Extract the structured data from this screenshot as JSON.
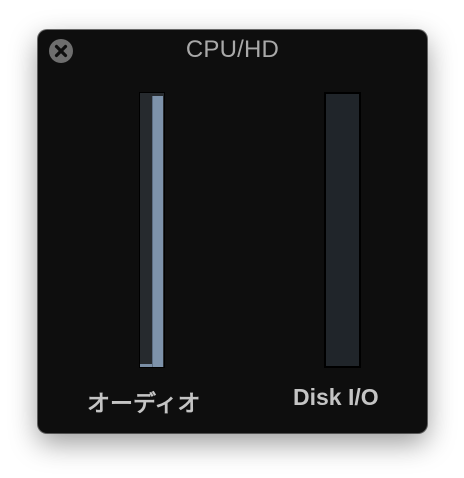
{
  "window": {
    "title": "CPU/HD"
  },
  "meters": {
    "audio": {
      "label": "オーディオ",
      "level_fraction": 0.99,
      "peak_fraction": 0.01
    },
    "disk": {
      "label": "Disk I/O",
      "level_fraction": 0.0
    }
  },
  "colors": {
    "window_bg": "#0e0e0e",
    "meter_fill": "#7d92aa",
    "meter_track": "#262a2e",
    "label_text": "#c4c4c4",
    "title_text": "#a9a9a9",
    "close_button": "#6e6e6e"
  },
  "icons": {
    "close": "close-icon"
  }
}
